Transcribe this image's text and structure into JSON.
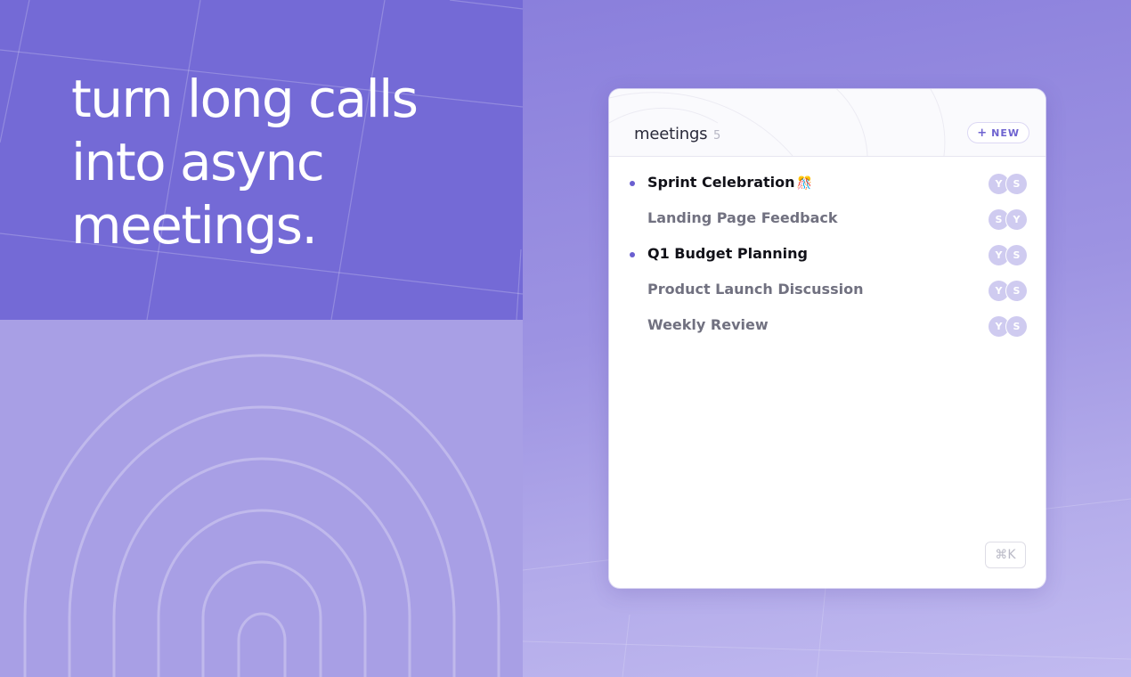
{
  "hero": {
    "headline": "turn long calls\ninto async\nmeetings."
  },
  "panel": {
    "title": "meetings",
    "count": "5",
    "new_button": "NEW",
    "shortcut": "⌘K"
  },
  "meetings": [
    {
      "title": "Sprint Celebration",
      "emoji": "🎊",
      "unread": true,
      "avatars": [
        "Y",
        "S"
      ]
    },
    {
      "title": "Landing Page Feedback",
      "emoji": "",
      "unread": false,
      "avatars": [
        "S",
        "Y"
      ]
    },
    {
      "title": "Q1 Budget Planning",
      "emoji": "",
      "unread": true,
      "avatars": [
        "Y",
        "S"
      ]
    },
    {
      "title": "Product Launch Discussion",
      "emoji": "",
      "unread": false,
      "avatars": [
        "Y",
        "S"
      ]
    },
    {
      "title": "Weekly Review",
      "emoji": "",
      "unread": false,
      "avatars": [
        "Y",
        "S"
      ]
    }
  ],
  "colors": {
    "hero_bg": "#746ad6",
    "accent": "#6a5fd0",
    "avatar_bg": "#cfcbf0"
  }
}
